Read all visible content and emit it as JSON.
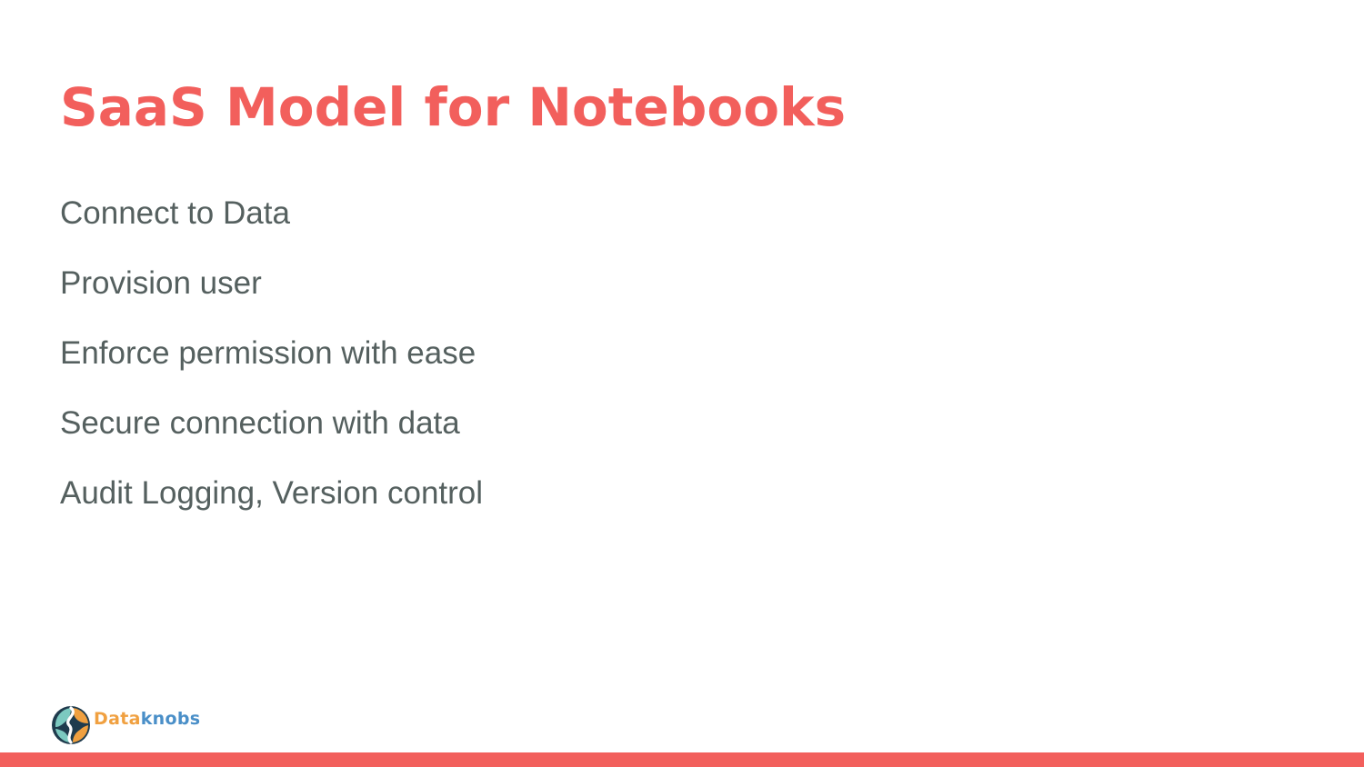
{
  "slide": {
    "title": "SaaS Model for Notebooks",
    "bullets": [
      "Connect to Data",
      "Provision user",
      "Enforce permission with ease",
      "Secure connection with data",
      "Audit Logging, Version control"
    ]
  },
  "logo": {
    "icon": "dataknobs-logo-icon",
    "name_part1": "Data",
    "name_part2": "knobs"
  },
  "colors": {
    "accent": "#f25f5c",
    "body_text": "#55605f",
    "logo_orange": "#f0a040",
    "logo_blue": "#4a8fc8",
    "logo_teal": "#7cc9c0",
    "logo_navy": "#1f3b4d"
  }
}
